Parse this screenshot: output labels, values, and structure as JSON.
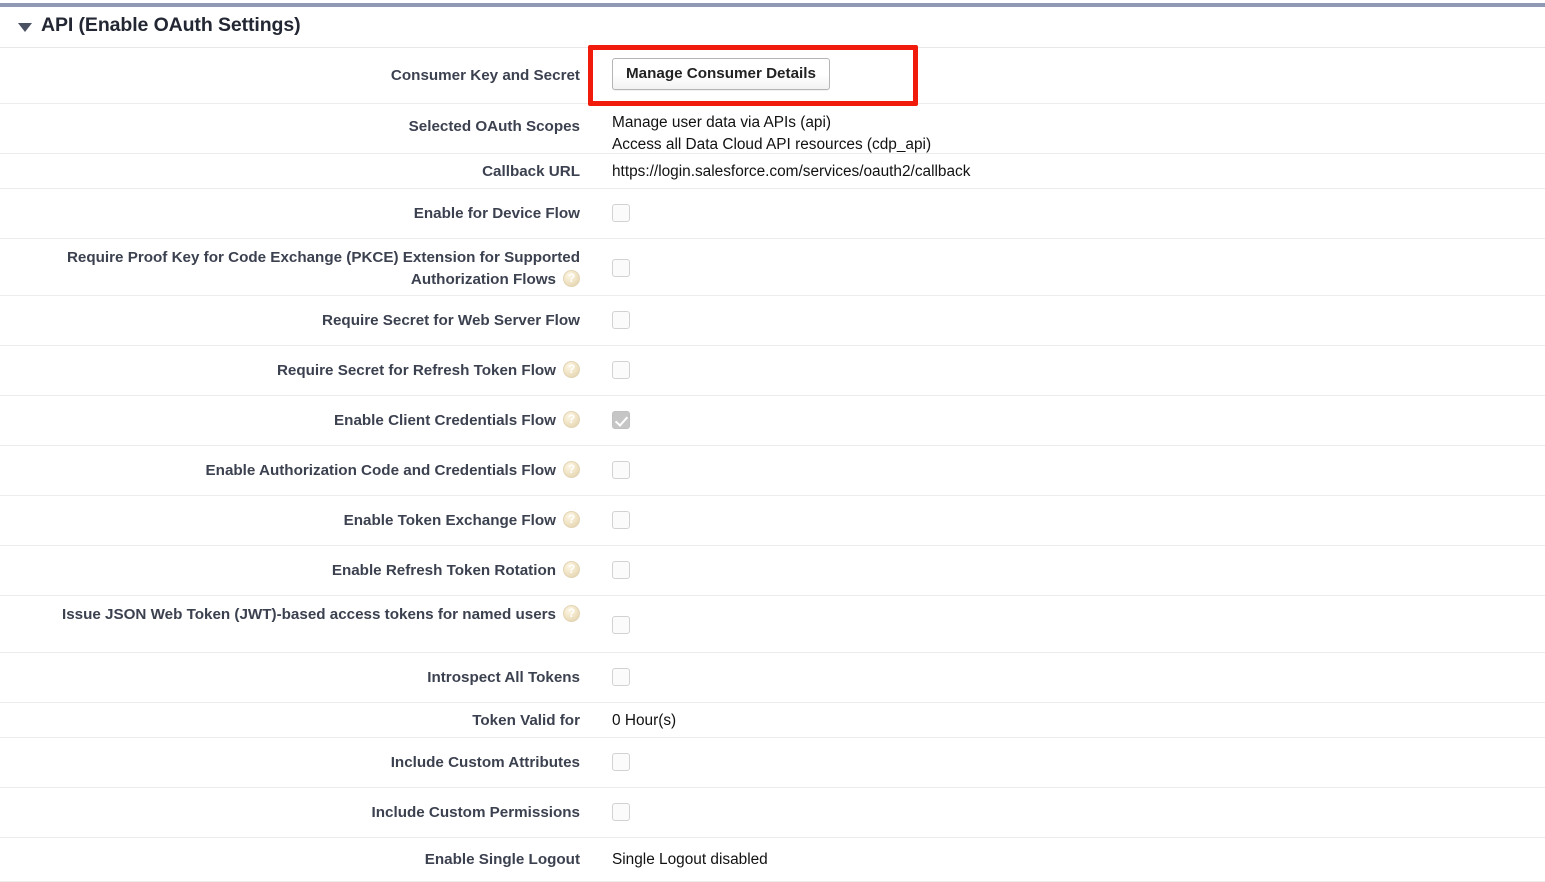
{
  "section": {
    "title": "API (Enable OAuth Settings)",
    "collapse_icon": "triangle-down-icon",
    "expanded": true
  },
  "colors": {
    "top_accent": "#8f98b4",
    "label_text": "#3c4150",
    "value_text": "#111111",
    "row_divider": "#ececec",
    "highlight_border": "#f01b0b",
    "checkbox_border": "#d2d2d2",
    "checkbox_checked_fill": "#c6c6c6",
    "help_icon_fill": "#e8dcc0"
  },
  "highlight": {
    "target": "manage-consumer-details-button",
    "visible": true
  },
  "rows": [
    {
      "label": "Consumer Key and Secret",
      "help": false,
      "type": "button",
      "button_label": "Manage Consumer Details"
    },
    {
      "label": "Selected OAuth Scopes",
      "help": false,
      "type": "multitext",
      "values": [
        "Manage user data via APIs (api)",
        "Access all Data Cloud API resources (cdp_api)"
      ]
    },
    {
      "label": "Callback URL",
      "help": false,
      "type": "text",
      "value": "https://login.salesforce.com/services/oauth2/callback"
    },
    {
      "label": "Enable for Device Flow",
      "help": false,
      "type": "checkbox",
      "checked": false
    },
    {
      "label": "Require Proof Key for Code Exchange (PKCE) Extension for Supported Authorization Flows",
      "help": true,
      "type": "checkbox",
      "checked": false
    },
    {
      "label": "Require Secret for Web Server Flow",
      "help": false,
      "type": "checkbox",
      "checked": false
    },
    {
      "label": "Require Secret for Refresh Token Flow",
      "help": true,
      "type": "checkbox",
      "checked": false
    },
    {
      "label": "Enable Client Credentials Flow",
      "help": true,
      "type": "checkbox",
      "checked": true
    },
    {
      "label": "Enable Authorization Code and Credentials Flow",
      "help": true,
      "type": "checkbox",
      "checked": false
    },
    {
      "label": "Enable Token Exchange Flow",
      "help": true,
      "type": "checkbox",
      "checked": false
    },
    {
      "label": "Enable Refresh Token Rotation",
      "help": true,
      "type": "checkbox",
      "checked": false
    },
    {
      "label": "Issue JSON Web Token (JWT)-based access tokens for named users",
      "help": true,
      "type": "checkbox",
      "checked": false
    },
    {
      "label": "Introspect All Tokens",
      "help": false,
      "type": "checkbox",
      "checked": false
    },
    {
      "label": "Token Valid for",
      "help": false,
      "type": "text",
      "value": "0 Hour(s)"
    },
    {
      "label": "Include Custom Attributes",
      "help": false,
      "type": "checkbox",
      "checked": false
    },
    {
      "label": "Include Custom Permissions",
      "help": false,
      "type": "checkbox",
      "checked": false
    },
    {
      "label": "Enable Single Logout",
      "help": false,
      "type": "text",
      "value": "Single Logout disabled"
    }
  ]
}
